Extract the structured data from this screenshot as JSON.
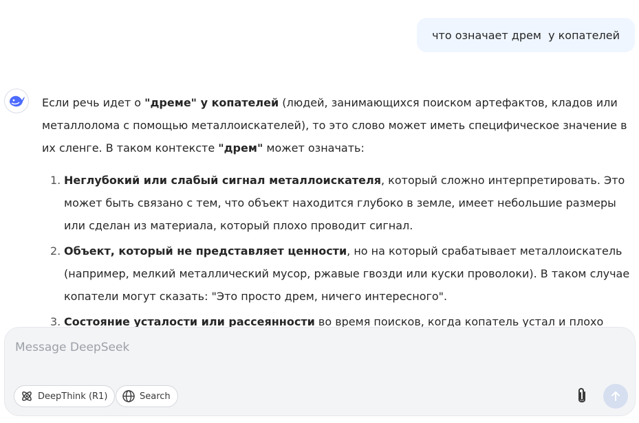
{
  "user_message": "что означает дрем  у копателей",
  "answer": {
    "intro": {
      "p1": "Если речь идет о ",
      "b1": "\"дреме\" у копателей",
      "p2": " (людей, занимающихся поиском артефактов, кладов или металлолома с помощью металлоискателей), то это слово может иметь специфическое значение в их сленге. В таком контексте ",
      "b2": "\"дрем\"",
      "p3": " может означать:"
    },
    "items": [
      {
        "num": "1.",
        "bold": "Неглубокий или слабый сигнал металлоискателя",
        "text": ", который сложно интерпретировать. Это может быть связано с тем, что объект находится глубоко в земле, имеет небольшие размеры или сделан из материала, который плохо проводит сигнал."
      },
      {
        "num": "2.",
        "bold": "Объект, который не представляет ценности",
        "text": ", но на который срабатывает металлоискатель (например, мелкий металлический мусор, ржавые гвозди или куски проволоки). В таком случае копатели могут сказать: \"Это просто дрем, ничего интересного\"."
      },
      {
        "num": "3.",
        "bold": "Состояние усталости или рассеянности",
        "text": " во время поисков, когда копатель устал и плохо"
      }
    ]
  },
  "composer": {
    "placeholder": "Message DeepSeek",
    "value": "",
    "deepthink_label": "DeepThink (R1)",
    "search_label": "Search"
  },
  "icons": {
    "avatar": "deepseek-whale-icon",
    "deepthink": "atom-icon",
    "search": "globe-icon",
    "attach": "paperclip-icon",
    "send": "arrow-up-icon"
  },
  "colors": {
    "accent": "#4d6bfe",
    "user_bubble": "#eff6ff",
    "composer_bg": "#f3f4f6",
    "send_disabled": "#d6dff0"
  }
}
